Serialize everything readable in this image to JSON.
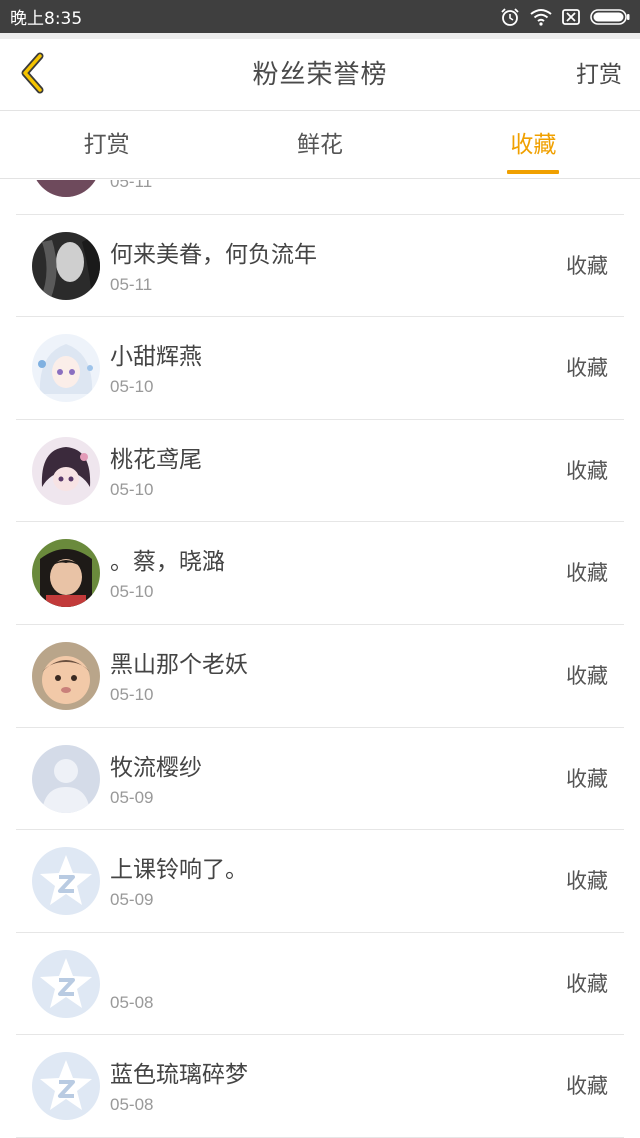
{
  "status_bar": {
    "time": "晚上8:35",
    "icons": [
      "alarm-icon",
      "wifi-icon",
      "sim-icon",
      "battery-icon"
    ]
  },
  "header": {
    "title": "粉丝荣誉榜",
    "back_icon": "chevron-left-icon",
    "action_label": "打赏"
  },
  "tabs": [
    {
      "label": "打赏",
      "active": false
    },
    {
      "label": "鲜花",
      "active": false
    },
    {
      "label": "收藏",
      "active": true
    }
  ],
  "colors": {
    "accent": "#f0a000",
    "status_bar": "#3f3f3f",
    "divider": "#e6e6e6"
  },
  "fans": [
    {
      "name": "",
      "date": "05-11",
      "action": "",
      "avatar": "avatar-photo-pink"
    },
    {
      "name": "何来美眷，何负流年",
      "date": "05-11",
      "action": "收藏",
      "avatar": "avatar-photo-bw"
    },
    {
      "name": "小甜辉燕",
      "date": "05-10",
      "action": "收藏",
      "avatar": "avatar-anime-white"
    },
    {
      "name": "桃花鸢尾",
      "date": "05-10",
      "action": "收藏",
      "avatar": "avatar-anime-dark"
    },
    {
      "name": "。蔡，晓潞",
      "date": "05-10",
      "action": "收藏",
      "avatar": "avatar-photo-girl"
    },
    {
      "name": "黑山那个老妖",
      "date": "05-10",
      "action": "收藏",
      "avatar": "avatar-photo-baby"
    },
    {
      "name": "牧流樱纱",
      "date": "05-09",
      "action": "收藏",
      "avatar": "avatar-default-person"
    },
    {
      "name": "上课铃响了。",
      "date": "05-09",
      "action": "收藏",
      "avatar": "avatar-default-qq"
    },
    {
      "name": "",
      "date": "05-08",
      "action": "收藏",
      "avatar": "avatar-default-qq"
    },
    {
      "name": "蓝色琉璃碎梦",
      "date": "05-08",
      "action": "收藏",
      "avatar": "avatar-default-qq"
    }
  ]
}
